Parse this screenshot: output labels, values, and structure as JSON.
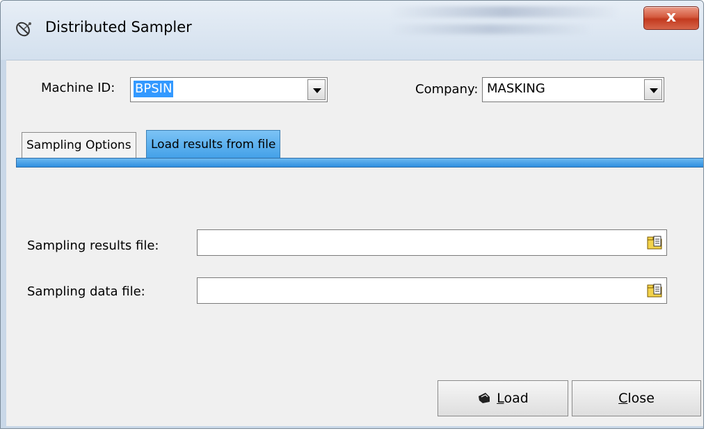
{
  "window": {
    "title": "Distributed Sampler",
    "close_glyph": "x",
    "app_icon": "satellite-dish-icon"
  },
  "header": {
    "machine_id_label": "Machine ID:",
    "machine_id_value": "BPSIN",
    "company_label": "Company:",
    "company_value": "MASKING"
  },
  "tabs": [
    {
      "label": "Sampling Options",
      "active": false
    },
    {
      "label": "Load results from file",
      "active": true
    }
  ],
  "form": {
    "results_file_label": "Sampling results file:",
    "results_file_value": "",
    "data_file_label": "Sampling data file:",
    "data_file_value": "",
    "browse_icon": "open-folder-icon"
  },
  "buttons": {
    "load_mnemonic": "L",
    "load_rest": "oad",
    "close_mnemonic": "C",
    "close_rest": "lose",
    "load_icon": "hand-load-icon"
  },
  "colors": {
    "accent": "#3399ff",
    "tab_active": "#42a0e8",
    "close_button": "#c23a1f"
  }
}
